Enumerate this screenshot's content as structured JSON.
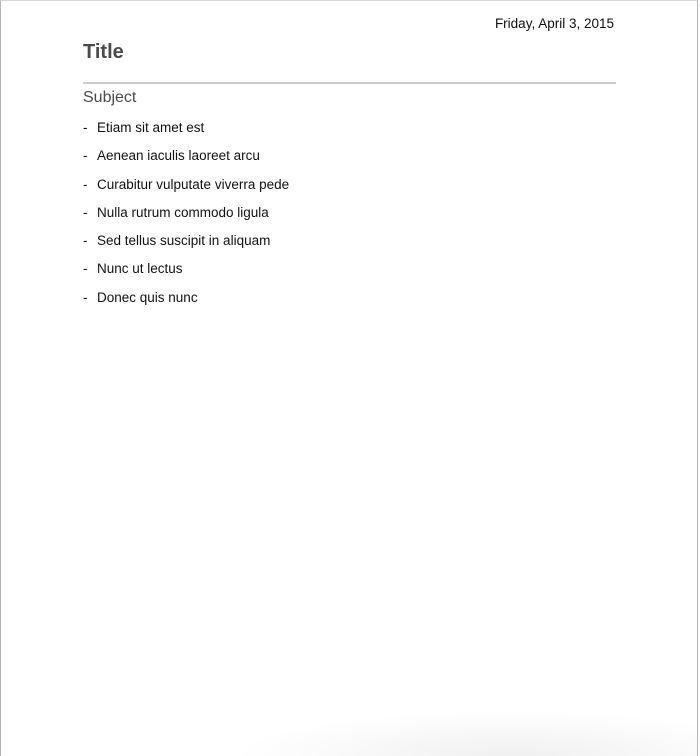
{
  "document": {
    "date": "Friday, April 3, 2015",
    "title": "Title",
    "subject": "Subject",
    "bullet_marker": "-",
    "items": [
      "Etiam sit amet est",
      "Aenean iaculis laoreet arcu",
      "Curabitur vulputate viverra pede",
      "Nulla rutrum commodo ligula",
      "Sed tellus suscipit in aliquam",
      "Nunc ut lectus",
      "Donec quis nunc"
    ]
  }
}
